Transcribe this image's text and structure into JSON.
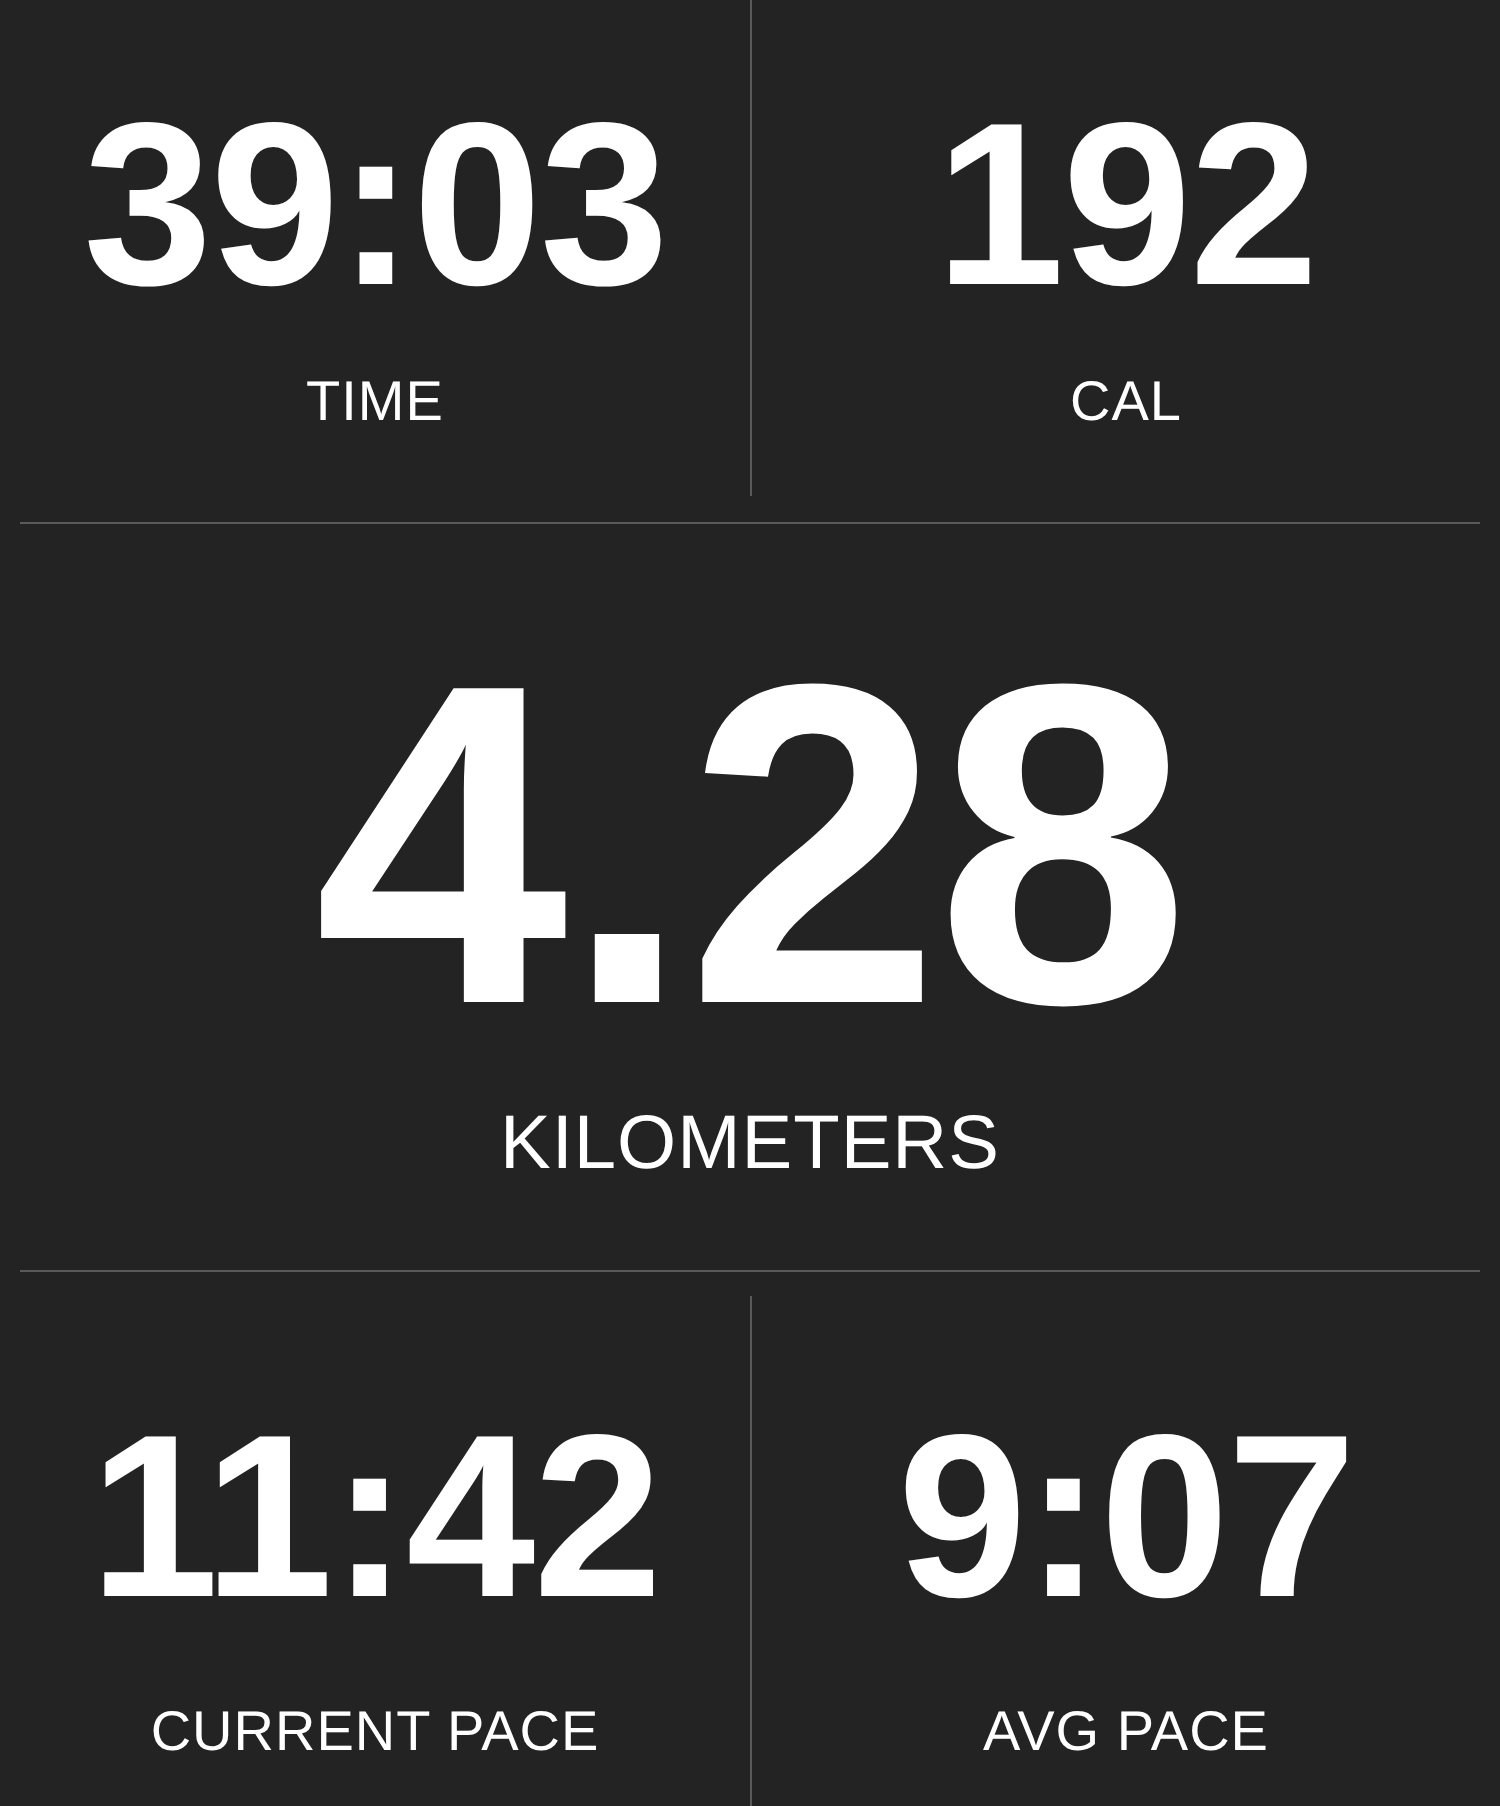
{
  "top_stats": [
    {
      "value": "39:03",
      "label": "TIME"
    },
    {
      "value": "192",
      "label": "CAL"
    }
  ],
  "distance": {
    "value": "4.28",
    "label": "KILOMETERS"
  },
  "bottom_stats": [
    {
      "value": "11:42",
      "label": "CURRENT PACE"
    },
    {
      "value": "9:07",
      "label": "AVG PACE"
    }
  ]
}
